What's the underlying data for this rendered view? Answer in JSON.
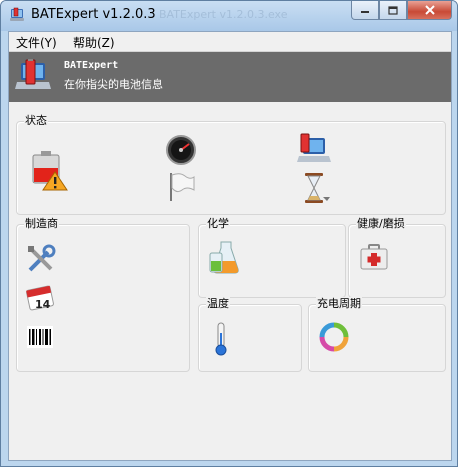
{
  "window": {
    "title": "BATExpert v1.2.0.3",
    "ghost_title": "BATExpert v1.2.0.3.exe"
  },
  "menu": {
    "items": [
      {
        "label": "文件(Y)"
      },
      {
        "label": "帮助(Z)"
      }
    ]
  },
  "header": {
    "app_name": "BATExpert",
    "subtitle": "在你指尖的电池信息"
  },
  "groups": {
    "status": {
      "label": "状态"
    },
    "manufacturer": {
      "label": "制造商"
    },
    "chemistry": {
      "label": "化学"
    },
    "health": {
      "label": "健康/磨损"
    },
    "temperature": {
      "label": "温度"
    },
    "charge_cycles": {
      "label": "充电周期"
    }
  },
  "icons": {
    "status": [
      "battery-warning-icon",
      "gauge-icon",
      "laptop-icon",
      "flag-icon",
      "hourglass-icon"
    ],
    "manufacturer": [
      "tools-icon",
      "calendar-icon",
      "barcode-icon"
    ],
    "chemistry": [
      "beaker-icon"
    ],
    "health": [
      "first-aid-kit-icon"
    ],
    "temperature": [
      "thermometer-icon"
    ],
    "charge_cycles": [
      "cycle-arrows-icon"
    ]
  },
  "calendar_day": "14",
  "colors": {
    "header_bg": "#6b6b6b",
    "client_bg": "#f0f0f0",
    "close_button": "#c84a36",
    "titlebar": "#bcd6ee"
  }
}
